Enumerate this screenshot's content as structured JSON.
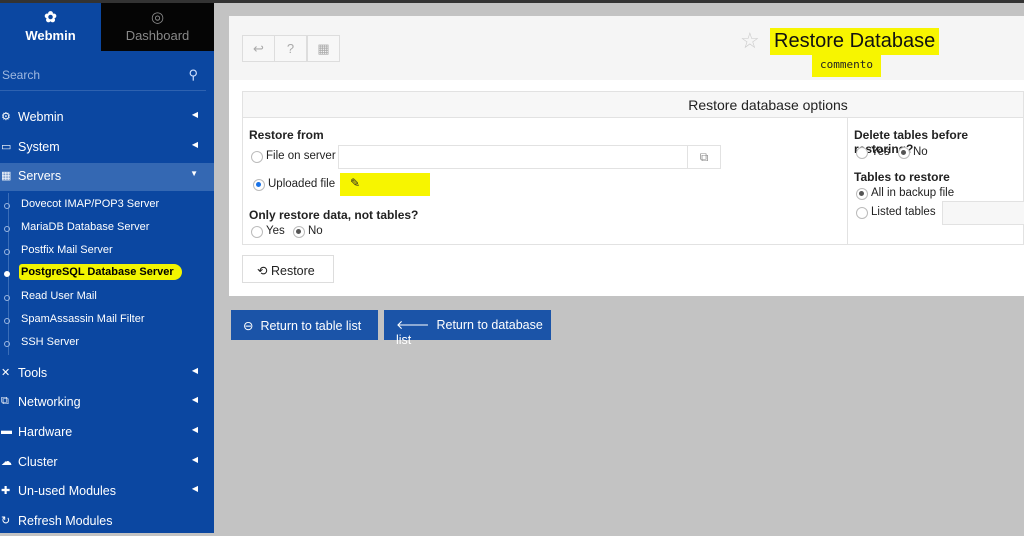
{
  "sidebar": {
    "tabs": [
      {
        "label": "Webmin",
        "icon": "webmin-logo-icon"
      },
      {
        "label": "Dashboard",
        "icon": "dashboard-gauge-icon"
      }
    ],
    "search_placeholder": "Search",
    "menu": [
      {
        "label": "Webmin",
        "icon": "gear-icon"
      },
      {
        "label": "System",
        "icon": "laptop-icon"
      },
      {
        "label": "Servers",
        "icon": "server-grid-icon",
        "expanded": true
      },
      {
        "label": "Tools",
        "icon": "tools-icon"
      },
      {
        "label": "Networking",
        "icon": "network-icon"
      },
      {
        "label": "Hardware",
        "icon": "hardware-icon"
      },
      {
        "label": "Cluster",
        "icon": "cluster-icon"
      },
      {
        "label": "Un-used Modules",
        "icon": "puzzle-icon"
      },
      {
        "label": "Refresh Modules",
        "icon": "refresh-icon"
      }
    ],
    "servers_sub": [
      "Dovecot IMAP/POP3 Server",
      "MariaDB Database Server",
      "Postfix Mail Server",
      "PostgreSQL Database Server",
      "Read User Mail",
      "SpamAssassin Mail Filter",
      "SSH Server"
    ],
    "selected_sub": "PostgreSQL Database Server"
  },
  "header": {
    "title": "Restore Database",
    "subtitle": "commento"
  },
  "options": {
    "section_title": "Restore database options",
    "restore_from_label": "Restore from",
    "file_on_server": "File on server",
    "uploaded_file": "Uploaded file",
    "only_data_label": "Only restore data, not tables?",
    "yes": "Yes",
    "no": "No",
    "delete_tables_label": "Delete tables before restoring?",
    "tables_label": "Tables to restore",
    "all_in_backup": "All in backup file",
    "listed_tables": "Listed tables"
  },
  "buttons": {
    "restore": "Restore",
    "return_table": "Return to table list",
    "return_db": "Return to database list"
  },
  "colors": {
    "sidebar": "#0b47a1",
    "accent": "#1b54a8",
    "highlight": "#f7f500"
  }
}
